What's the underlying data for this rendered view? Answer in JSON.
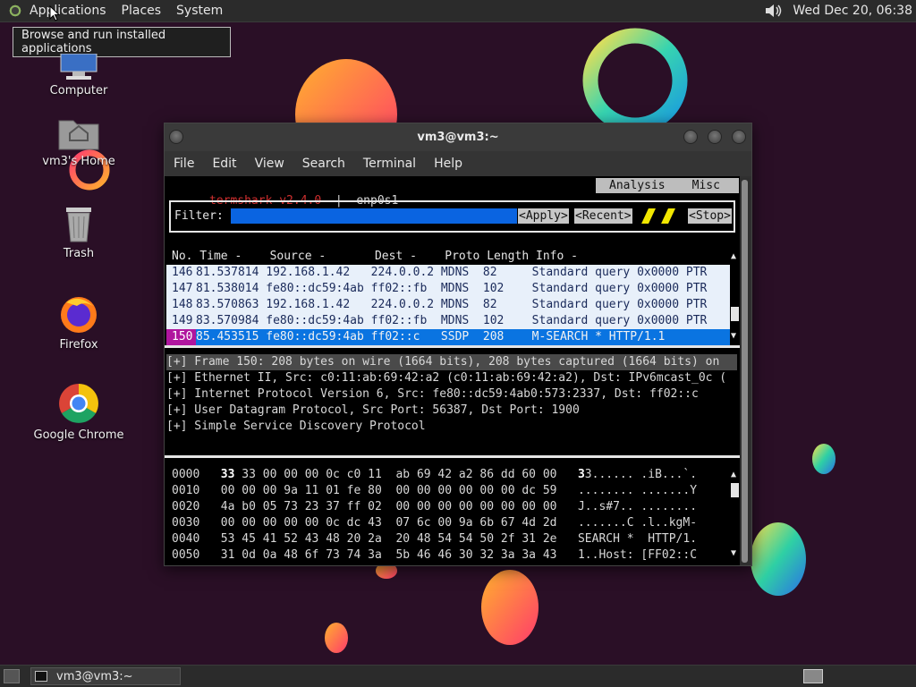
{
  "top_panel": {
    "menus": [
      "Applications",
      "Places",
      "System"
    ],
    "clock": "Wed Dec 20, 06:38"
  },
  "tooltip": "Browse and run installed applications",
  "desktop_icons": [
    {
      "label": "Computer",
      "icon": "computer-icon"
    },
    {
      "label": "vm3's Home",
      "icon": "home-folder-icon"
    },
    {
      "label": "Trash",
      "icon": "trash-icon"
    },
    {
      "label": "Firefox",
      "icon": "firefox-icon"
    },
    {
      "label": "Google Chrome",
      "icon": "chrome-icon"
    }
  ],
  "window": {
    "title": "vm3@vm3:~",
    "menu": [
      "File",
      "Edit",
      "View",
      "Search",
      "Terminal",
      "Help"
    ]
  },
  "termshark": {
    "app": "termshark v2.4.0",
    "separator": "|",
    "interface": "enp0s1",
    "tabs": [
      "Analysis",
      "Misc"
    ],
    "filter_label": "Filter:",
    "buttons": {
      "apply": "<Apply>",
      "recent": "<Recent>",
      "stop": "<Stop>"
    },
    "columns": "No. Time -    Source -       Dest -    Proto Length Info -",
    "packets": [
      {
        "no": "146",
        "rest": "81.537814 192.168.1.42   224.0.0.2 MDNS  82     Standard query 0x0000 PTR"
      },
      {
        "no": "147",
        "rest": "81.538014 fe80::dc59:4ab ff02::fb  MDNS  102    Standard query 0x0000 PTR"
      },
      {
        "no": "148",
        "rest": "83.570863 192.168.1.42   224.0.0.2 MDNS  82     Standard query 0x0000 PTR"
      },
      {
        "no": "149",
        "rest": "83.570984 fe80::dc59:4ab ff02::fb  MDNS  102    Standard query 0x0000 PTR"
      },
      {
        "no": "150",
        "rest": "85.453515 fe80::dc59:4ab ff02::c   SSDP  208    M-SEARCH * HTTP/1.1"
      }
    ],
    "details": [
      "[+] Frame 150: 208 bytes on wire (1664 bits), 208 bytes captured (1664 bits) on",
      "[+] Ethernet II, Src: c0:11:ab:69:42:a2 (c0:11:ab:69:42:a2), Dst: IPv6mcast_0c (",
      "[+] Internet Protocol Version 6, Src: fe80::dc59:4ab0:573:2337, Dst: ff02::c",
      "[+] User Datagram Protocol, Src Port: 56387, Dst Port: 1900",
      "[+] Simple Service Discovery Protocol"
    ],
    "hex": [
      {
        "off": "0000",
        "first": "33",
        "bytes": " 33 00 00 00 0c c0 11  ab 69 42 a2 86 dd 60 00",
        "asciifirst": "3",
        "ascii": "3...... .iB...`."
      },
      {
        "off": "0010",
        "first": "",
        "bytes": "00 00 00 9a 11 01 fe 80  00 00 00 00 00 00 dc 59",
        "asciifirst": "",
        "ascii": "........ .......Y"
      },
      {
        "off": "0020",
        "first": "",
        "bytes": "4a b0 05 73 23 37 ff 02  00 00 00 00 00 00 00 00",
        "asciifirst": "",
        "ascii": "J..s#7.. ........"
      },
      {
        "off": "0030",
        "first": "",
        "bytes": "00 00 00 00 00 0c dc 43  07 6c 00 9a 6b 67 4d 2d",
        "asciifirst": "",
        "ascii": ".......C .l..kgM-"
      },
      {
        "off": "0040",
        "first": "",
        "bytes": "53 45 41 52 43 48 20 2a  20 48 54 54 50 2f 31 2e",
        "asciifirst": "",
        "ascii": "SEARCH *  HTTP/1."
      },
      {
        "off": "0050",
        "first": "",
        "bytes": "31 0d 0a 48 6f 73 74 3a  5b 46 46 30 32 3a 3a 43",
        "asciifirst": "",
        "ascii": "1..Host: [FF02::C"
      }
    ]
  },
  "bottom_panel": {
    "task": "vm3@vm3:~"
  }
}
